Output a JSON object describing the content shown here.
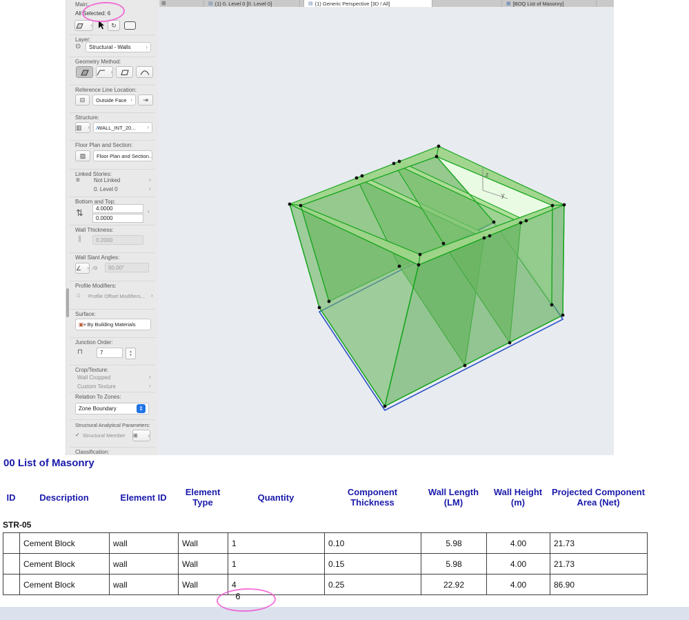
{
  "colors": {
    "annotation_pink": "#f353cf",
    "selection_green": "#14a51c",
    "reference_blue": "#2b50c8",
    "header_blue": "#1a1aab",
    "accent_blue": "#1f74e8"
  },
  "icons": {
    "window_grid": "⊞",
    "document": "▤",
    "table_document": "▦",
    "chevron_right": "›",
    "chevron_down": "▾",
    "eye": "⊙",
    "rotate": "↻",
    "reference_line": "⊟",
    "flip_arrow": "⇥",
    "wall_section": "▥",
    "pencil": "∕",
    "hatch": "▨",
    "stories": "≡",
    "bottom_top": "⇅",
    "thickness": "∥",
    "angle": "∠",
    "slant_alpha": "∕α",
    "profile": "⌂",
    "paint": "▣",
    "junction": "⊓",
    "up": "▴",
    "down": "▾",
    "zone_stepper": "⇕",
    "check": "✓",
    "member_grid": "⊞"
  },
  "tabbar": {
    "tabs": [
      {
        "label": "(1) 0. Level 0 [0. Level 0]"
      },
      {
        "label": "(1) Generic Perspective [3D / All]"
      },
      {
        "label": "[BOQ List of Masonry]"
      }
    ]
  },
  "infobox": {
    "main_label": "Main:",
    "selection_status": "All Selected: 6",
    "layer": {
      "label": "Layer:",
      "value": "Structural - Walls"
    },
    "geometry_method_label": "Geometry Method:",
    "reference_line": {
      "label": "Reference Line Location:",
      "value": "Outside Face"
    },
    "structure": {
      "label": "Structure:",
      "value": "WALL_INT_20..."
    },
    "floor_plan_section": {
      "label": "Floor Plan and Section:",
      "value": "Floor Plan and Section..."
    },
    "linked_stories": {
      "label": "Linked Stories:",
      "not_linked": "Not Linked",
      "home_story": "0. Level 0"
    },
    "bottom_top": {
      "label": "Bottom and Top:",
      "top_value": "4.0000",
      "bottom_value": "0.0000"
    },
    "wall_thickness": {
      "label": "Wall Thickness:",
      "value": "0.2000"
    },
    "slant": {
      "label": "Wall Slant Angles:",
      "alpha": "∕α",
      "value": "90.00°"
    },
    "profile_modifiers": {
      "label": "Profile Modifiers:",
      "value": "Profile Offset Modifiers..."
    },
    "surface": {
      "label": "Surface:",
      "value": "By Building Materials"
    },
    "junction_order": {
      "label": "Junction Order:",
      "value": "7"
    },
    "crop_texture": {
      "label": "Crop/Texture:",
      "row1": "Wall Cropped",
      "row2": "Custom Texture"
    },
    "relation_to_zones": {
      "label": "Relation To Zones:",
      "value": "Zone Boundary"
    },
    "structural_params": {
      "label": "Structural Analytical Parameters:",
      "value": "Structural Member"
    },
    "classification_label": "Classification:"
  },
  "viewport": {
    "axis": {
      "z": "z",
      "y": "y"
    }
  },
  "boq": {
    "title": "00 List of Masonry",
    "headers": [
      "ID",
      "Description",
      "Element ID",
      "Element Type",
      "Quantity",
      "Component Thickness",
      "Wall Length (LM)",
      "Wall Height (m)",
      "Projected Component Area (Net)"
    ],
    "group": "STR-05",
    "rows": [
      {
        "description": "Cement Block",
        "element_id": "wall",
        "element_type": "Wall",
        "quantity": "1",
        "thickness": "0.10",
        "length": "5.98",
        "height": "4.00",
        "area": "21.73"
      },
      {
        "description": "Cement Block",
        "element_id": "wall",
        "element_type": "Wall",
        "quantity": "1",
        "thickness": "0.15",
        "length": "5.98",
        "height": "4.00",
        "area": "21.73"
      },
      {
        "description": "Cement Block",
        "element_id": "wall",
        "element_type": "Wall",
        "quantity": "4",
        "thickness": "0.25",
        "length": "22.92",
        "height": "4.00",
        "area": "86.90"
      }
    ],
    "total_quantity": "6"
  }
}
